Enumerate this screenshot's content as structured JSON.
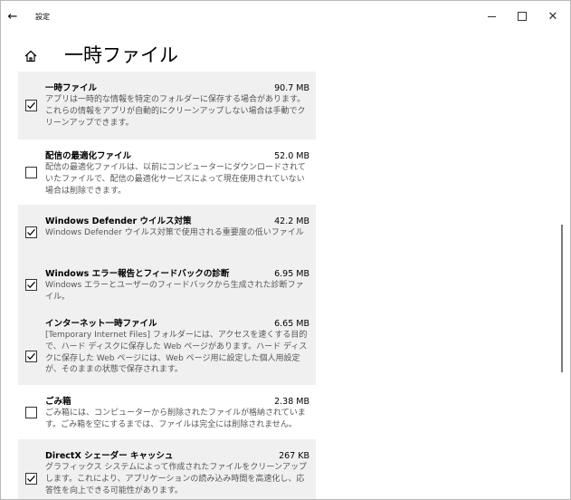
{
  "window": {
    "title": "設定",
    "back_glyph": "←",
    "close_glyph": "✕"
  },
  "header": {
    "title": "一時ファイル"
  },
  "items": [
    {
      "name": "一時ファイル",
      "size": "90.7 MB",
      "checked": true,
      "description": "アプリは一時的な情報を特定のフォルダーに保存する場合があります。これらの情報をアプリが自動的にクリーンアップしない場合は手動でクリーンアップできます。"
    },
    {
      "name": "配信の最適化ファイル",
      "size": "52.0 MB",
      "checked": false,
      "description": "配信の最適化ファイルは、以前にコンピューターにダウンロードされていたファイルで、配信の最適化サービスによって現在使用されていない場合は削除できます。"
    },
    {
      "name": "Windows Defender ウイルス対策",
      "size": "42.2 MB",
      "checked": true,
      "description": "Windows Defender ウイルス対策で使用される重要度の低いファイル"
    },
    {
      "name": "Windows エラー報告とフィードバックの診断",
      "size": "6.95 MB",
      "checked": true,
      "description": "Windows エラーとユーザーのフィードバックから生成された診断ファイル。"
    },
    {
      "name": "インターネット一時ファイル",
      "size": "6.65 MB",
      "checked": true,
      "description": "[Temporary Internet Files] フォルダーには、アクセスを速くする目的で、ハード ディスクに保存した Web ページがあります。ハード ディスクに保存した Web ページには、Web ページ用に設定した個人用設定が、そのままの状態で保存されます。"
    },
    {
      "name": "ごみ箱",
      "size": "2.38 MB",
      "checked": false,
      "description": "ごみ箱には、コンピューターから削除されたファイルが格納されています。ごみ箱を空にするまでは、ファイルは完全には削除されません。"
    },
    {
      "name": "DirectX シェーダー キャッシュ",
      "size": "267 KB",
      "checked": true,
      "description": "グラフィックス システムによって作成されたファイルをクリーンアップします。これにより、アプリケーションの読み込み時間を高速化し、応答性を向上できる可能性があります。"
    }
  ]
}
